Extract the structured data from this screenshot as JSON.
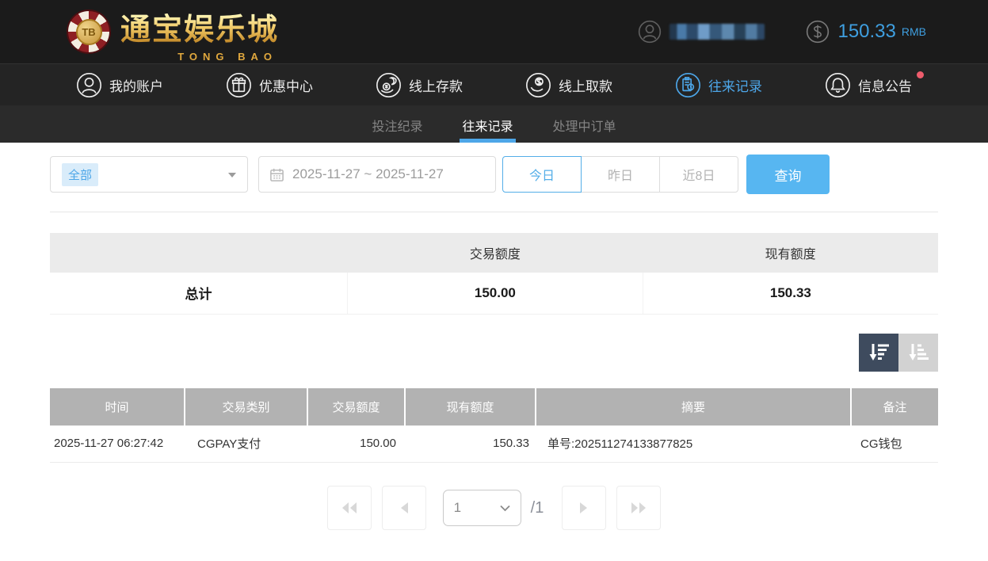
{
  "header": {
    "logo": {
      "chip_text": "TB",
      "brand_cn": "通宝娱乐城",
      "brand_en": "TONG BAO"
    },
    "user": {
      "username_redacted": true
    },
    "balance": {
      "amount": "150.33",
      "currency": "RMB"
    }
  },
  "nav": {
    "items": [
      {
        "label": "我的账户",
        "icon": "user-circle-icon",
        "active": false
      },
      {
        "label": "优惠中心",
        "icon": "gift-circle-icon",
        "active": false
      },
      {
        "label": "线上存款",
        "icon": "deposit-hand-coin-icon",
        "active": false
      },
      {
        "label": "线上取款",
        "icon": "withdraw-hand-coin-icon",
        "active": false
      },
      {
        "label": "往来记录",
        "icon": "records-clipboard-icon",
        "active": true
      },
      {
        "label": "信息公告",
        "icon": "bell-icon",
        "active": false,
        "badge_dot": true
      }
    ]
  },
  "tabs": [
    {
      "label": "投注纪录",
      "active": false
    },
    {
      "label": "往来记录",
      "active": true
    },
    {
      "label": "处理中订单",
      "active": false
    }
  ],
  "filters": {
    "type_selected": "全部",
    "date_range": "2025-11-27 ~ 2025-11-27",
    "quick_ranges": [
      "今日",
      "昨日",
      "近8日"
    ],
    "active_quick_range": "今日",
    "search_label": "查询"
  },
  "summary_table": {
    "headers": [
      "",
      "交易额度",
      "现有额度"
    ],
    "row": {
      "label": "总计",
      "trade_amount": "150.00",
      "current_amount": "150.33"
    }
  },
  "sort": {
    "active": "descending"
  },
  "records_table": {
    "headers": [
      "时间",
      "交易类别",
      "交易额度",
      "现有额度",
      "摘要",
      "备注"
    ],
    "rows": [
      {
        "time": "2025-11-27 06:27:42",
        "type": "CGPAY支付",
        "trade_amount": "150.00",
        "current_amount": "150.33",
        "summary": "单号:202511274133877825",
        "remark": "CG钱包"
      }
    ]
  },
  "pagination": {
    "current_page": "1",
    "total_label": "/1"
  },
  "colors": {
    "accent_blue": "#54aee8",
    "search_button_blue": "#57b6f1",
    "header_dark": "#1b1b1b",
    "nav_dark": "#242424",
    "tabbar_dark": "#2b2b2b",
    "records_header_gray": "#b2b2b2",
    "summary_header_gray": "#ebebeb",
    "sort_active_navy": "#3e4b5e",
    "badge_red": "#ee5c6c",
    "brand_gold": "#e8b64c"
  }
}
